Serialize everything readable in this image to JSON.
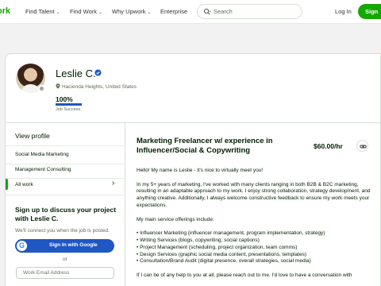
{
  "nav": {
    "logo": "ork",
    "links": [
      "Find Talent",
      "Find Work",
      "Why Upwork",
      "Enterprise"
    ],
    "search_placeholder": "Search",
    "login": "Log In",
    "signup": "Sign"
  },
  "profile": {
    "name": "Leslie C.",
    "location": "Hacienda Heights, United States",
    "jss_value": "100%",
    "jss_fraction": 1.0,
    "jss_label": "Job Success"
  },
  "sidebar": {
    "title": "View profile",
    "items": [
      "Social Media Marketing",
      "Management Consulting",
      "All work"
    ],
    "signup_title": "Sign up to discuss your project with Leslie C.",
    "signup_sub": "We'll connect you when the job is posted.",
    "google_label": "Sign In with Google",
    "google_glyph": "G",
    "or": "or",
    "email_placeholder": "Work Email Address"
  },
  "main": {
    "title": "Marketing Freelancer w/ experience in Influencer/Social & Copywriting",
    "rate": "$60.00/hr",
    "bio": [
      "Hello! My name is Leslie - it's nice to virtually meet you!",
      "",
      "In my 5+ years of marketing, I've worked with many clients ranging in both B2B & B2C marketing, resulting in an adaptable approach to my work. I enjoy strong collaboration, strategy development, and anything creative. Additionally, I always welcome constructive feedback to ensure my work meets your expectations.",
      "",
      "My main service offerings include:",
      "",
      "• Influencer Marketing (influencer management, program implementation, strategy)",
      "• Writing Services (blogs, copywriting, social captions)",
      "• Project Management (scheduling, project organization, team comms)",
      "• Design Services (graphic social media content, presentations, templates)",
      "• Consultation/Brand Audit (digital presence, overall strategies, social media)",
      "",
      "If I can be of any help to you at all, please reach out to me. I'd love to have a conversation with"
    ]
  },
  "colors": {
    "brand": "#14a800",
    "link_blue": "#1f57c3"
  }
}
